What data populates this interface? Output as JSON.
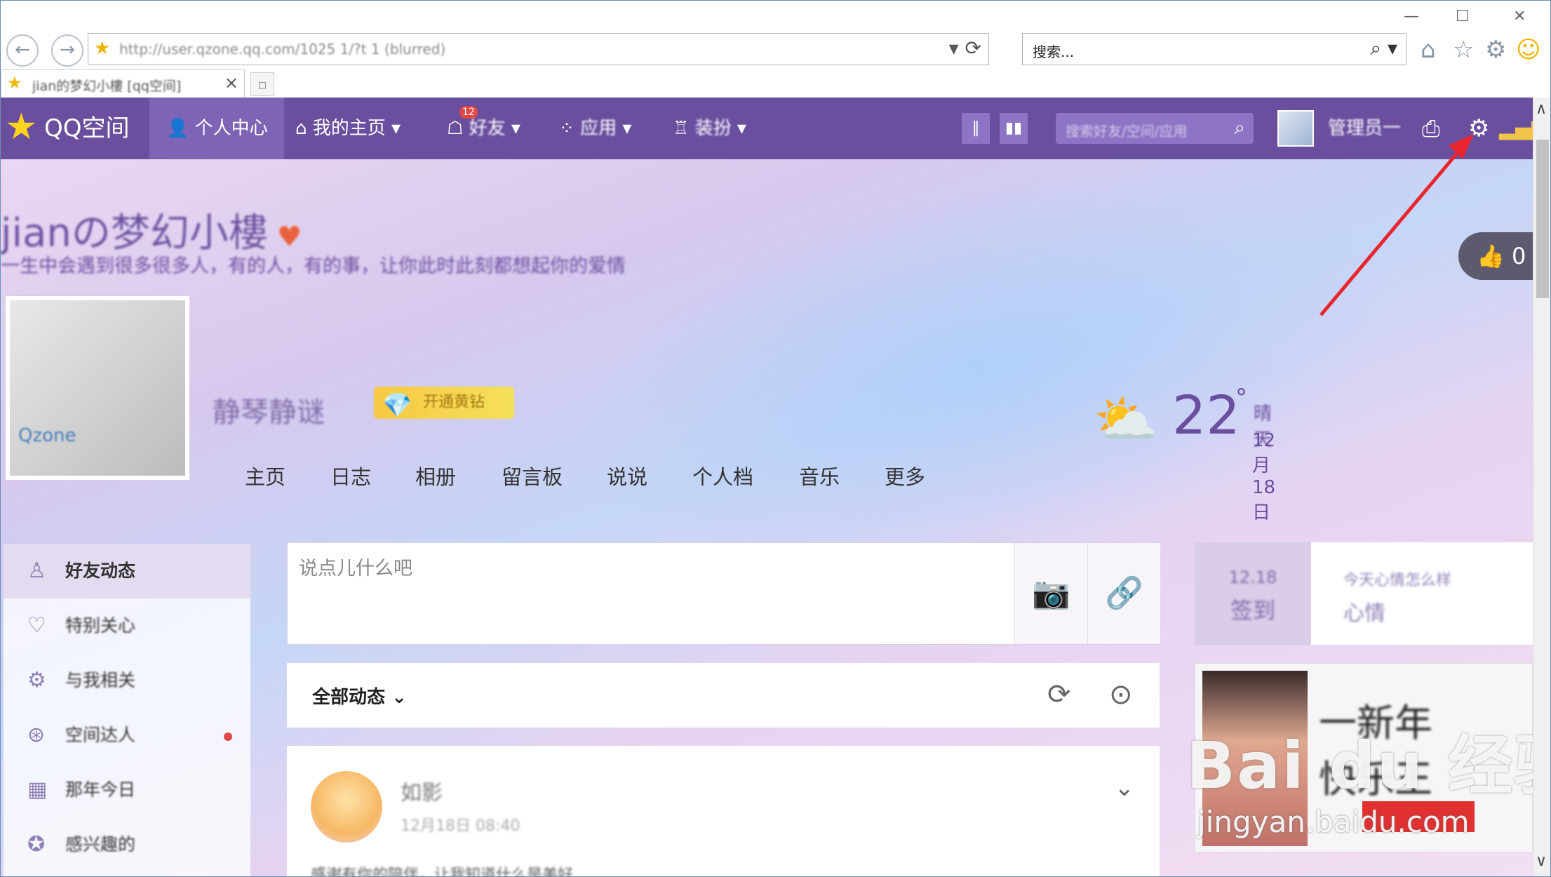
{
  "browser": {
    "url": "http://user.qzone.qq.com/1025 1/?t 1 (blurred)",
    "search_placeholder": "搜索...",
    "tab_title": "jian的梦幻小樓 [qq空间]"
  },
  "topbar": {
    "logo": "QQ空间",
    "nav": [
      {
        "label": "个人中心"
      },
      {
        "label": "我的主页"
      },
      {
        "label": "好友"
      },
      {
        "label": "应用"
      },
      {
        "label": "装扮"
      }
    ],
    "badge": "12",
    "search_placeholder": "搜索好友/空间/应用",
    "username": "管理员一"
  },
  "space": {
    "title": "jianの梦幻小樓",
    "subtitle": "一生中会遇到很多很多人，有的人，有的事，让你此时此刻都想起你的爱情",
    "avatar_text": "Qzone",
    "username": "静琴静谜",
    "vip_label": "开通黄钻",
    "nav": [
      "主页",
      "日志",
      "相册",
      "留言板",
      "说说",
      "个人档",
      "音乐",
      "更多"
    ]
  },
  "weather": {
    "temp": "22",
    "deg": "°",
    "city": "晴天",
    "date": "12月18日"
  },
  "like_count": "0",
  "sidebar": {
    "items": [
      {
        "label": "好友动态"
      },
      {
        "label": "特别关心"
      },
      {
        "label": "与我相关"
      },
      {
        "label": "空间达人"
      },
      {
        "label": "那年今日"
      },
      {
        "label": "感兴趣的"
      }
    ]
  },
  "composer": {
    "placeholder": "说点儿什么吧"
  },
  "feed_filter": {
    "label": "全部动态"
  },
  "feed_item": {
    "name": "如影",
    "time": "12月18日 08:40",
    "text": "感谢有你的陪伴，让我知道什么是美好……"
  },
  "right_panel": {
    "tab1_top": "12.18",
    "tab1_bottom": "签到",
    "tab2_top": "今天心情怎么样",
    "tab2_bottom": "心情",
    "promo_line1": "一新年",
    "promo_line2": "快乐王"
  },
  "watermark": {
    "line1": "Bai du 经验",
    "line2": "jingyan.baidu.com"
  },
  "colors": {
    "qzone_bar": "#6a4f9f",
    "accent": "#8e7fb6",
    "arrow": "#e8252f"
  }
}
